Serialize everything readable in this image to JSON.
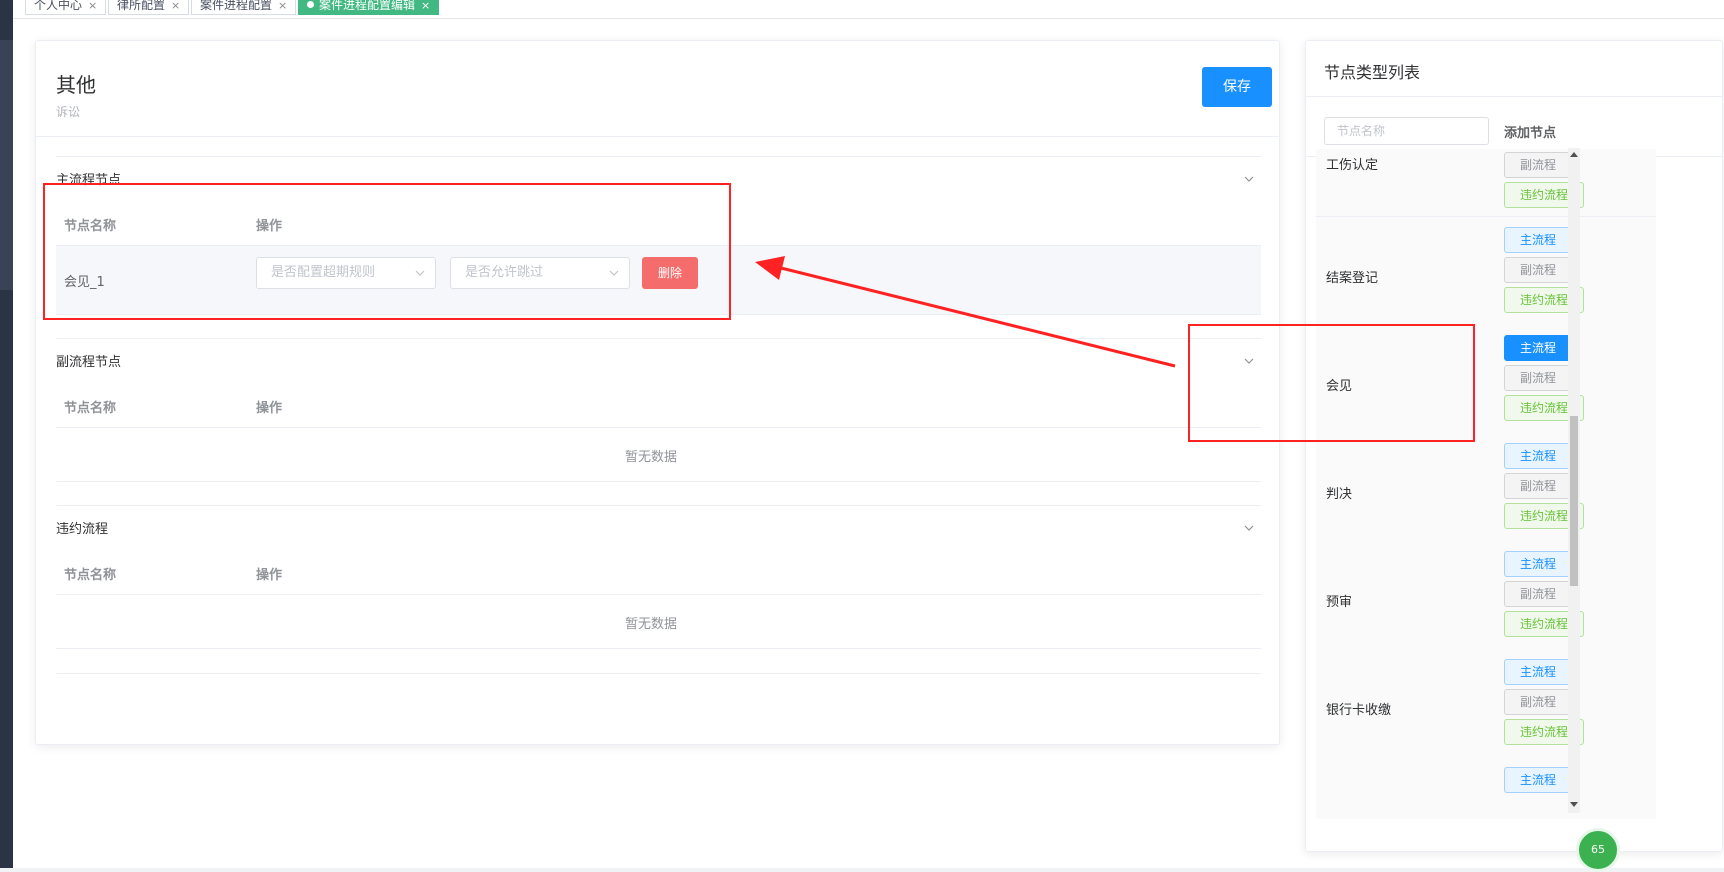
{
  "tabs": [
    {
      "label": "个人中心",
      "active": false
    },
    {
      "label": "律所配置",
      "active": false
    },
    {
      "label": "案件进程配置",
      "active": false
    },
    {
      "label": "案件进程配置编辑",
      "active": true
    }
  ],
  "tab_close": "×",
  "header": {
    "title": "其他",
    "subtitle": "诉讼",
    "save_label": "保存"
  },
  "columns": {
    "name": "节点名称",
    "action": "操作"
  },
  "sections": {
    "main": {
      "title": "主流程节点",
      "rows": [
        {
          "name": "会见_1",
          "select1_placeholder": "是否配置超期规则",
          "select2_placeholder": "是否允许跳过",
          "delete_label": "删除"
        }
      ]
    },
    "sub": {
      "title": "副流程节点",
      "empty_text": "暂无数据"
    },
    "breach": {
      "title": "违约流程",
      "empty_text": "暂无数据"
    }
  },
  "side": {
    "title": "节点类型列表",
    "search_placeholder": "节点名称",
    "add_label": "添加节点",
    "tag_labels": {
      "main": "主流程",
      "sub": "副流程",
      "breach": "违约流程"
    },
    "items": [
      {
        "name": "工伤认定"
      },
      {
        "name": "结案登记"
      },
      {
        "name": "会见",
        "main_selected": true
      },
      {
        "name": "判决"
      },
      {
        "name": "预审"
      },
      {
        "name": "银行卡收缴"
      }
    ]
  },
  "badge": {
    "text": "65"
  },
  "colors": {
    "primary": "#1890ff",
    "danger": "#f56c6c",
    "success": "#67c23a",
    "tab_active": "#42b983",
    "annotation": "#ff2222"
  }
}
